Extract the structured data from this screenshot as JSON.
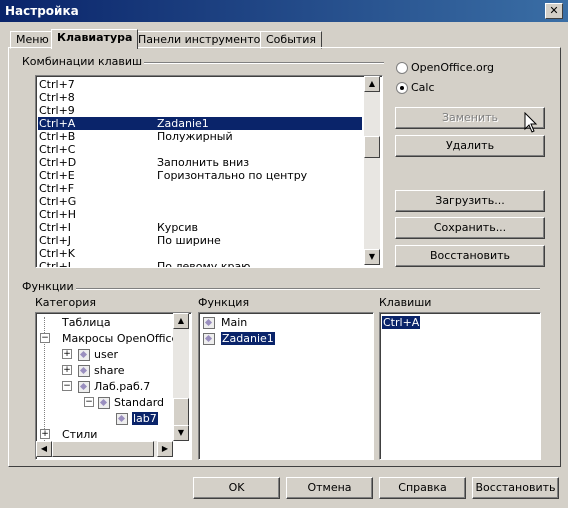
{
  "window": {
    "title": "Настройка",
    "close": "✕"
  },
  "tabs": [
    "Меню",
    "Клавиатура",
    "Панели инструментов",
    "События"
  ],
  "shortcuts_group": "Комбинации клавиш",
  "shortcuts": [
    {
      "key": "Ctrl+7",
      "func": ""
    },
    {
      "key": "Ctrl+8",
      "func": ""
    },
    {
      "key": "Ctrl+9",
      "func": ""
    },
    {
      "key": "Ctrl+A",
      "func": "Zadanie1",
      "selected": true
    },
    {
      "key": "Ctrl+B",
      "func": "Полужирный"
    },
    {
      "key": "Ctrl+C",
      "func": ""
    },
    {
      "key": "Ctrl+D",
      "func": "Заполнить вниз"
    },
    {
      "key": "Ctrl+E",
      "func": "Горизонтально по центру"
    },
    {
      "key": "Ctrl+F",
      "func": ""
    },
    {
      "key": "Ctrl+G",
      "func": ""
    },
    {
      "key": "Ctrl+H",
      "func": ""
    },
    {
      "key": "Ctrl+I",
      "func": "Курсив"
    },
    {
      "key": "Ctrl+J",
      "func": "По ширине"
    },
    {
      "key": "Ctrl+K",
      "func": ""
    },
    {
      "key": "Ctrl+L",
      "func": "По левому краю"
    }
  ],
  "scope": {
    "openoffice": "OpenOffice.org",
    "calc": "Calc",
    "selected": "calc"
  },
  "buttons": {
    "replace": "Заменить",
    "delete": "Удалить",
    "load": "Загрузить...",
    "save": "Сохранить...",
    "restore": "Восстановить"
  },
  "functions_group": "Функции",
  "columns": {
    "category": "Категория",
    "function": "Функция",
    "keys": "Клавиши"
  },
  "category_tree": [
    {
      "label": "Таблица"
    },
    {
      "label": "Макросы OpenOffice.o"
    },
    {
      "label": "user"
    },
    {
      "label": "share"
    },
    {
      "label": "Лаб.раб.7"
    },
    {
      "label": "Standard"
    },
    {
      "label": "lab7",
      "selected": true
    },
    {
      "label": "Стили"
    }
  ],
  "function_list": [
    {
      "label": "Main"
    },
    {
      "label": "Zadanie1",
      "selected": true
    }
  ],
  "keys_list": [
    {
      "label": "Ctrl+A",
      "selected": true
    }
  ],
  "footer": {
    "ok": "OK",
    "cancel": "Отмена",
    "help": "Справка",
    "reset": "Восстановить"
  },
  "colors": {
    "selection": "#0a246a",
    "face": "#d4d0c8",
    "title_start": "#0a246a",
    "title_end": "#3a6ea5"
  },
  "icons": [
    "close-icon",
    "radio-icon",
    "expand-icon",
    "collapse-icon",
    "dialog-macro-icon",
    "scroll-up-icon",
    "scroll-down-icon",
    "scroll-left-icon",
    "scroll-right-icon",
    "mouse-pointer-icon"
  ]
}
